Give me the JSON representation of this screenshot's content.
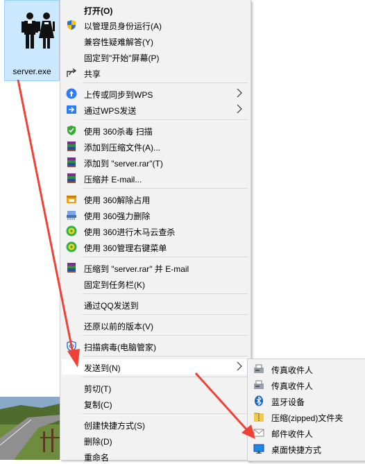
{
  "file": {
    "name": "server.exe"
  },
  "menu": {
    "items": [
      {
        "label": "打开(O)",
        "icon": "open",
        "bold": true
      },
      {
        "label": "以管理员身份运行(A)",
        "icon": "shield-uac-icon"
      },
      {
        "label": "兼容性疑难解答(Y)",
        "icon": ""
      },
      {
        "label": "固定到\"开始\"屏幕(P)",
        "icon": ""
      },
      {
        "label": "共享",
        "icon": "share-icon"
      },
      {
        "label": "上传或同步到WPS",
        "icon": "wps-cloud-icon",
        "submenu": true
      },
      {
        "label": "通过WPS发送",
        "icon": "wps-send-icon",
        "submenu": true
      },
      {
        "label": "使用 360杀毒 扫描",
        "icon": "360-antivirus-icon"
      },
      {
        "label": "添加到压缩文件(A)...",
        "icon": "winrar-icon"
      },
      {
        "label": "添加到 \"server.rar\"(T)",
        "icon": "winrar-icon"
      },
      {
        "label": "压缩并 E-mail...",
        "icon": "winrar-icon"
      },
      {
        "label": "使用 360解除占用",
        "icon": "360-unlock-icon"
      },
      {
        "label": "使用 360强力删除",
        "icon": "360-shred-icon"
      },
      {
        "label": "使用 360进行木马云查杀",
        "icon": "360-cloud-scan-icon"
      },
      {
        "label": "使用 360管理右键菜单",
        "icon": "360-menu-manage-icon"
      },
      {
        "label": "压缩到 \"server.rar\" 并 E-mail",
        "icon": "winrar-icon"
      },
      {
        "label": "固定到任务栏(K)",
        "icon": ""
      },
      {
        "label": "通过QQ发送到",
        "icon": ""
      },
      {
        "label": "还原以前的版本(V)",
        "icon": ""
      },
      {
        "label": "扫描病毒(电脑管家)",
        "icon": "tencent-pc-manager-icon"
      },
      {
        "label": "发送到(N)",
        "icon": "",
        "submenu": true,
        "highlighted": true
      },
      {
        "label": "剪切(T)",
        "icon": ""
      },
      {
        "label": "复制(C)",
        "icon": ""
      },
      {
        "label": "创建快捷方式(S)",
        "icon": ""
      },
      {
        "label": "删除(D)",
        "icon": ""
      },
      {
        "label": "重命名",
        "icon": ""
      }
    ]
  },
  "submenu": {
    "items": [
      {
        "label": "传真收件人",
        "icon": "fax-icon"
      },
      {
        "label": "传真收件人",
        "icon": "fax-icon"
      },
      {
        "label": "蓝牙设备",
        "icon": "bluetooth-icon"
      },
      {
        "label": "压缩(zipped)文件夹",
        "icon": "zip-folder-icon"
      },
      {
        "label": "邮件收件人",
        "icon": "mail-icon"
      },
      {
        "label": "桌面快捷方式",
        "icon": "desktop-shortcut-icon"
      }
    ]
  },
  "colors": {
    "annotation_arrow": "#ef4136",
    "menu_bg": "#f2f2f2",
    "file_selected": "#cce8ff"
  }
}
